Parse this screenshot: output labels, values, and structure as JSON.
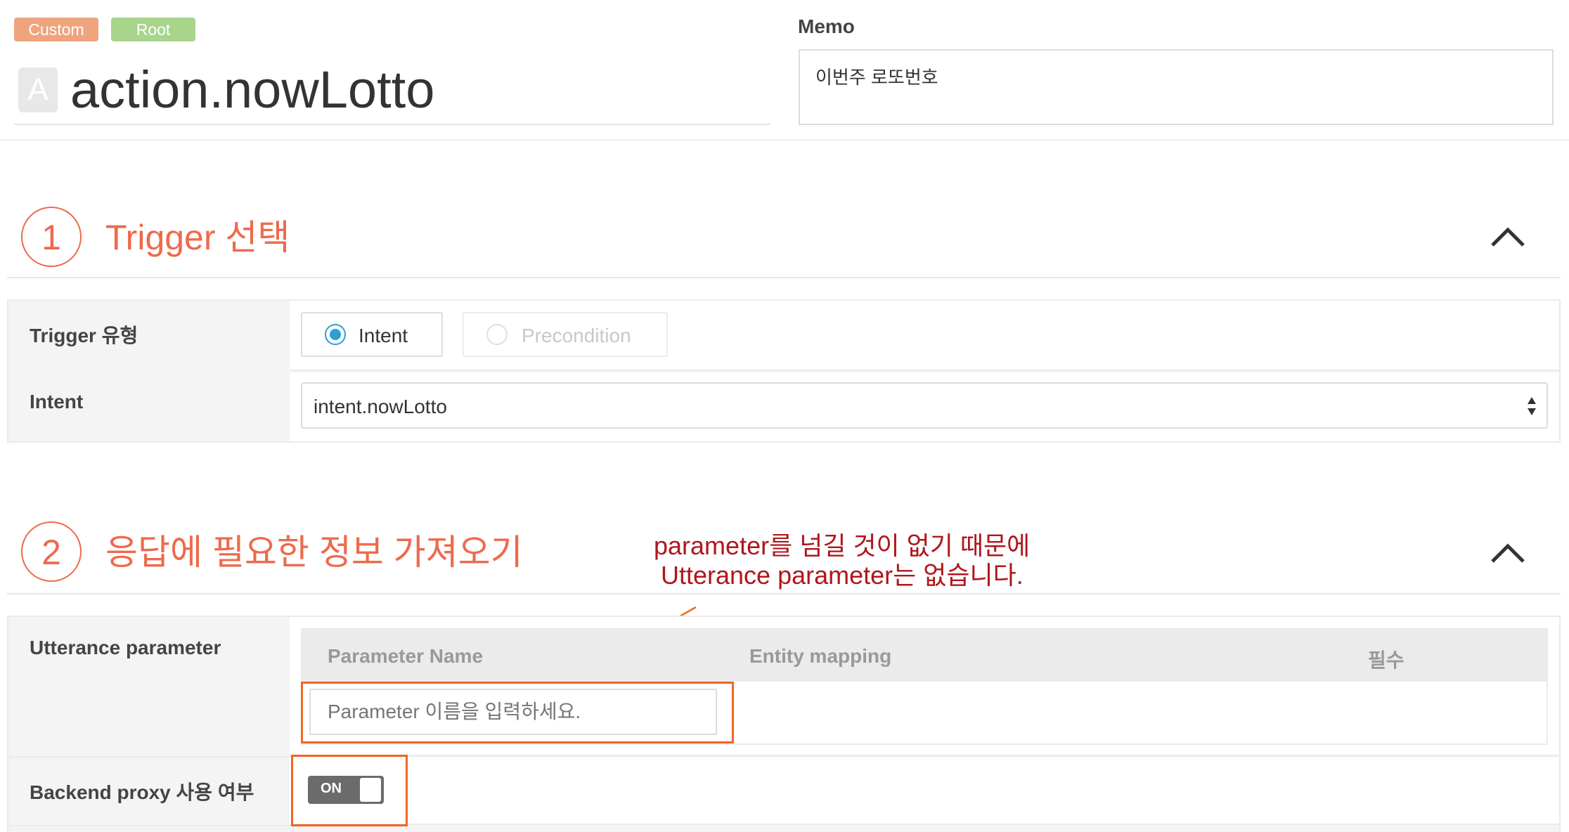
{
  "header": {
    "tags": [
      "Custom",
      "Root"
    ],
    "title_icon_letter": "A",
    "title": "action.nowLotto",
    "memo_label": "Memo",
    "memo_value": "이번주 로또번호"
  },
  "section1": {
    "number": "1",
    "title": "Trigger 선택",
    "trigger_type_label": "Trigger 유형",
    "radio_options": [
      "Intent",
      "Precondition"
    ],
    "selected_option": "Intent",
    "intent_label": "Intent",
    "intent_value": "intent.nowLotto"
  },
  "section2": {
    "number": "2",
    "title": "응답에 필요한 정보 가져오기",
    "utterance_label": "Utterance parameter",
    "columns": [
      "Parameter Name",
      "Entity mapping",
      "필수"
    ],
    "param_placeholder": "Parameter 이름을 입력하세요.",
    "backend_label": "Backend proxy 사용 여부",
    "toggle_state": "ON"
  },
  "annotation": {
    "line1": "parameter를 넘길 것이 없기 때문에",
    "line2": "Utterance parameter는 없습니다."
  },
  "colors": {
    "accent": "#ee6a4c",
    "annotation": "#b0161c",
    "highlight_box": "#f26522",
    "radio_selected": "#2a9fd8"
  }
}
